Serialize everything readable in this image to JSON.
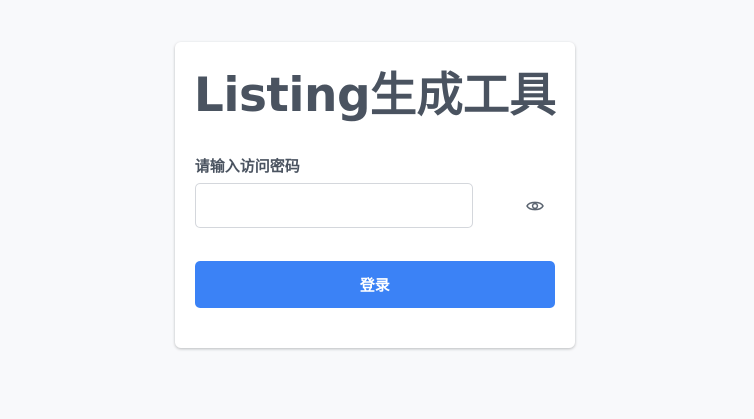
{
  "login_card": {
    "title": "Listing生成工具",
    "password_label": "请输入访问密码",
    "password_value": "",
    "password_placeholder": "",
    "toggle_icon": "eye-icon",
    "login_button_label": "登录"
  },
  "colors": {
    "background": "#f8f9fb",
    "card": "#ffffff",
    "text": "#4a5360",
    "accent": "#3b82f6"
  }
}
